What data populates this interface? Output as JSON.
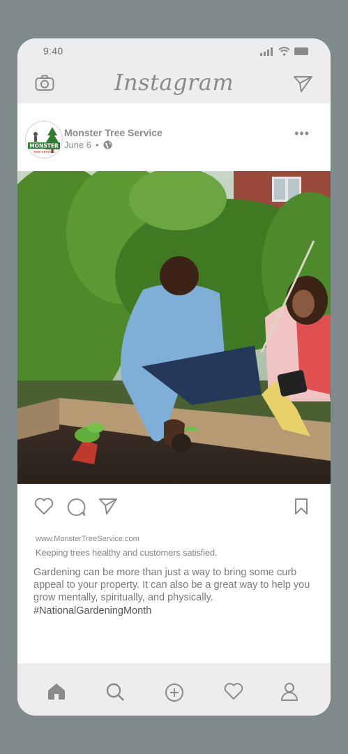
{
  "status_bar": {
    "time": "9:40"
  },
  "header": {
    "logo": "Instagram",
    "camera_icon": "camera-icon",
    "send_icon": "paper-plane-icon"
  },
  "post": {
    "account_name": "Monster Tree Service",
    "date": "June 6",
    "separator": "•",
    "avatar_text_top": "MONSTER",
    "avatar_text_bottom": "tree service",
    "more": "•••",
    "website": "www.MonsterTreeService.com",
    "tagline": "Keeping trees healthy and customers satisfied.",
    "caption": "Gardening can be more than just a way to bring some curb appeal to your property. It can also be a great way to help you grow mentally, spiritually, and physically.",
    "hashtag": "#NationalGardeningMonth"
  },
  "bottom_nav": [
    "home-icon",
    "search-icon",
    "add-icon",
    "heart-icon",
    "profile-icon"
  ],
  "colors": {
    "frame": "#7f8a8a",
    "chrome": "#ededf0",
    "icon": "#8a8a8e",
    "brand_green": "#2e7d32",
    "brand_red": "#c62828"
  }
}
